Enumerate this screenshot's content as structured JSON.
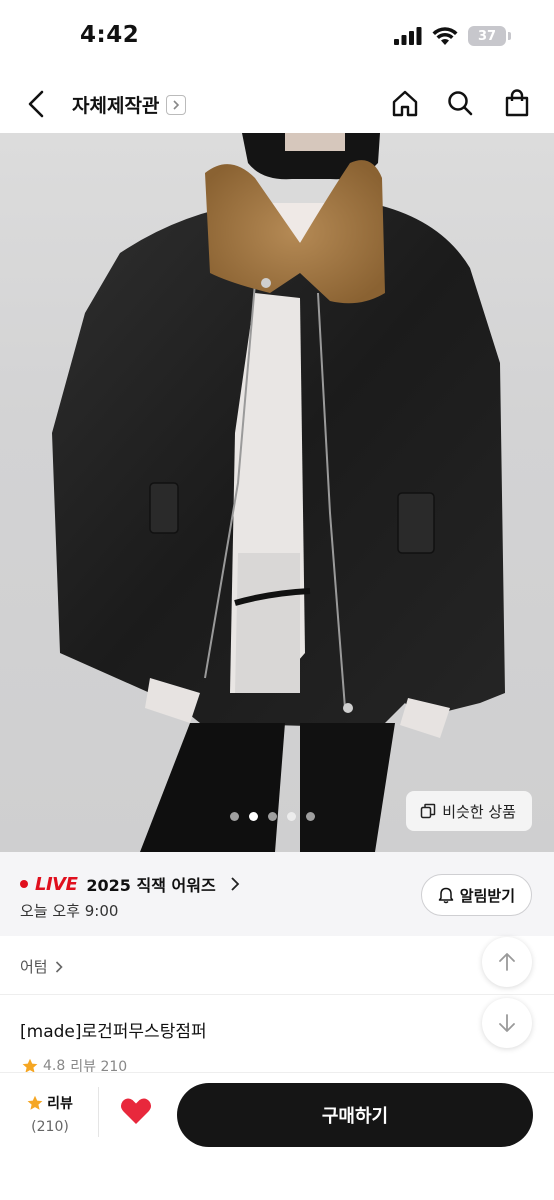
{
  "status_bar": {
    "time": "4:42",
    "battery": "37"
  },
  "header": {
    "title": "자체제작관"
  },
  "hero": {
    "similar_button": "비슷한 상품",
    "carousel": {
      "total": 5,
      "active_index": 1
    }
  },
  "live": {
    "badge": "LIVE",
    "title": "2025 직잭 어워즈",
    "time": "오늘 오후 9:00",
    "alarm_button": "알림받기",
    "accent_color": "#e0101e"
  },
  "product": {
    "brand": "어텀",
    "title": "[made]로건퍼무스탕점퍼",
    "rating": "4.8",
    "review_label": "리뷰 210"
  },
  "bottom_bar": {
    "review_label": "리뷰",
    "review_count": "(210)",
    "buy_button": "구매하기",
    "heart_color": "#e8283c"
  }
}
